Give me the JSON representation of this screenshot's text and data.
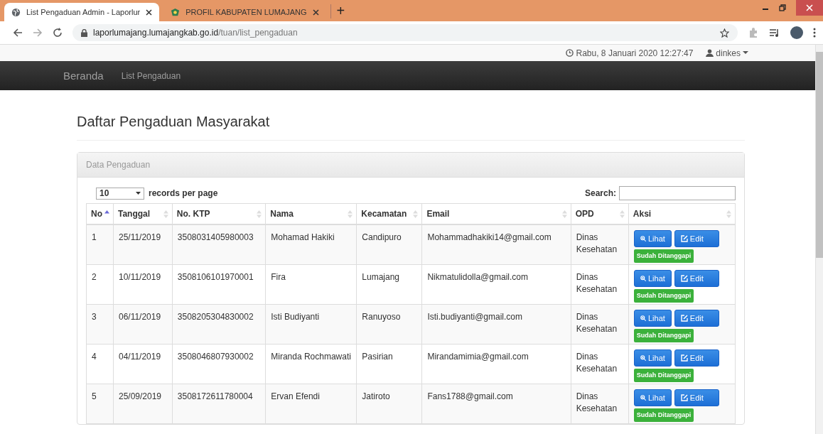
{
  "browser": {
    "tabs": [
      {
        "title": "List Pengaduan Admin - Laporlur",
        "selected": true
      },
      {
        "title": "PROFIL KABUPATEN LUMAJANG",
        "selected": false
      }
    ],
    "new_tab": "+",
    "url_host": "laporlumajang.lumajangkab.go.id",
    "url_path": "/tuan/list_pengaduan"
  },
  "topbar": {
    "datetime": "Rabu, 8 Januari 2020 12:27:47",
    "user": "dinkes"
  },
  "navbar": {
    "brand": "Beranda",
    "links": [
      "List Pengaduan"
    ]
  },
  "page_title": "Daftar Pengaduan Masyarakat",
  "panel": {
    "heading": "Data Pengaduan",
    "page_size": "10",
    "page_size_label": "records per page",
    "search_label": "Search:",
    "columns": [
      {
        "label": "No",
        "sorted": true
      },
      {
        "label": "Tanggal",
        "sorted": false
      },
      {
        "label": "No. KTP",
        "sorted": false
      },
      {
        "label": "Nama",
        "sorted": false
      },
      {
        "label": "Kecamatan",
        "sorted": false
      },
      {
        "label": "Email",
        "sorted": false
      },
      {
        "label": "OPD",
        "sorted": false
      },
      {
        "label": "Aksi",
        "sorted": false
      }
    ],
    "rows": [
      {
        "no": "1",
        "tanggal": "25/11/2019",
        "ktp": "3508031405980003",
        "nama": "Mohamad Hakiki",
        "kecamatan": "Candipuro",
        "email": "Mohammadhakiki14@gmail.com",
        "opd": "Dinas Kesehatan",
        "view": "Lihat",
        "edit": "Edit",
        "status": "Sudah Ditanggapi"
      },
      {
        "no": "2",
        "tanggal": "10/11/2019",
        "ktp": "3508106101970001",
        "nama": "Fira",
        "kecamatan": "Lumajang",
        "email": "Nikmatulidolla@gmail.com",
        "opd": "Dinas Kesehatan",
        "view": "Lihat",
        "edit": "Edit",
        "status": "Sudah Ditanggapi"
      },
      {
        "no": "3",
        "tanggal": "06/11/2019",
        "ktp": "3508205304830002",
        "nama": "Isti Budiyanti",
        "kecamatan": "Ranuyoso",
        "email": "Isti.budiyanti@gmail.com",
        "opd": "Dinas Kesehatan",
        "view": "Lihat",
        "edit": "Edit",
        "status": "Sudah Ditanggapi"
      },
      {
        "no": "4",
        "tanggal": "04/11/2019",
        "ktp": "3508046807930002",
        "nama": "Miranda Rochmawati",
        "kecamatan": "Pasirian",
        "email": "Mirandamimia@gmail.com",
        "opd": "Dinas Kesehatan",
        "view": "Lihat",
        "edit": "Edit",
        "status": "Sudah Ditanggapi"
      },
      {
        "no": "5",
        "tanggal": "25/09/2019",
        "ktp": "3508172611780004",
        "nama": "Ervan Efendi",
        "kecamatan": "Jatiroto",
        "email": "Fans1788@gmail.com",
        "opd": "Dinas Kesehatan",
        "view": "Lihat",
        "edit": "Edit",
        "status": "Sudah Ditanggapi"
      }
    ]
  }
}
